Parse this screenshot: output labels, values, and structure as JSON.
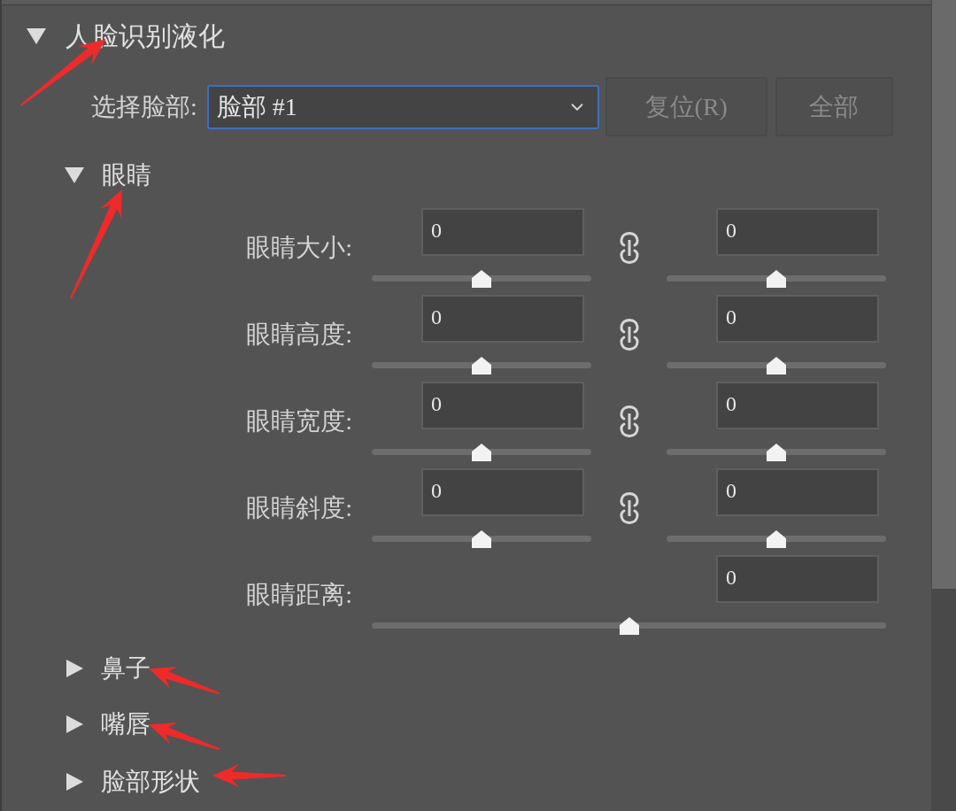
{
  "panel": {
    "title": "人脸识别液化",
    "expanded": true,
    "annotation": {
      "kind": "upright"
    }
  },
  "face_select": {
    "label": "选择脸部:",
    "value": "脸部 #1",
    "focused": true
  },
  "buttons": [
    {
      "label": "复位(R)",
      "disabled": true
    },
    {
      "label": "全部",
      "disabled": true
    }
  ],
  "sections": [
    {
      "title": "眼睛",
      "expanded": true,
      "annotation": {
        "kind": "up"
      },
      "controls": [
        {
          "kind": "pair",
          "label": "眼睛大小:",
          "linked": true,
          "left": {
            "value": "0",
            "level": 0.5
          },
          "right": {
            "value": "0",
            "level": 0.5
          }
        },
        {
          "kind": "pair",
          "label": "眼睛高度:",
          "linked": true,
          "left": {
            "value": "0",
            "level": 0.5
          },
          "right": {
            "value": "0",
            "level": 0.5
          }
        },
        {
          "kind": "pair",
          "label": "眼睛宽度:",
          "linked": true,
          "left": {
            "value": "0",
            "level": 0.5
          },
          "right": {
            "value": "0",
            "level": 0.5
          }
        },
        {
          "kind": "pair",
          "label": "眼睛斜度:",
          "linked": true,
          "left": {
            "value": "0",
            "level": 0.5
          },
          "right": {
            "value": "0",
            "level": 0.5
          }
        },
        {
          "kind": "single",
          "label": "眼睛距离:",
          "value": "0",
          "level": 0.5
        }
      ]
    },
    {
      "title": "鼻子",
      "expanded": false,
      "annotation": {
        "kind": "leftdown"
      }
    },
    {
      "title": "嘴唇",
      "expanded": false,
      "annotation": {
        "kind": "leftdown"
      }
    },
    {
      "title": "脸部形状",
      "expanded": false,
      "annotation": {
        "kind": "left"
      }
    }
  ]
}
